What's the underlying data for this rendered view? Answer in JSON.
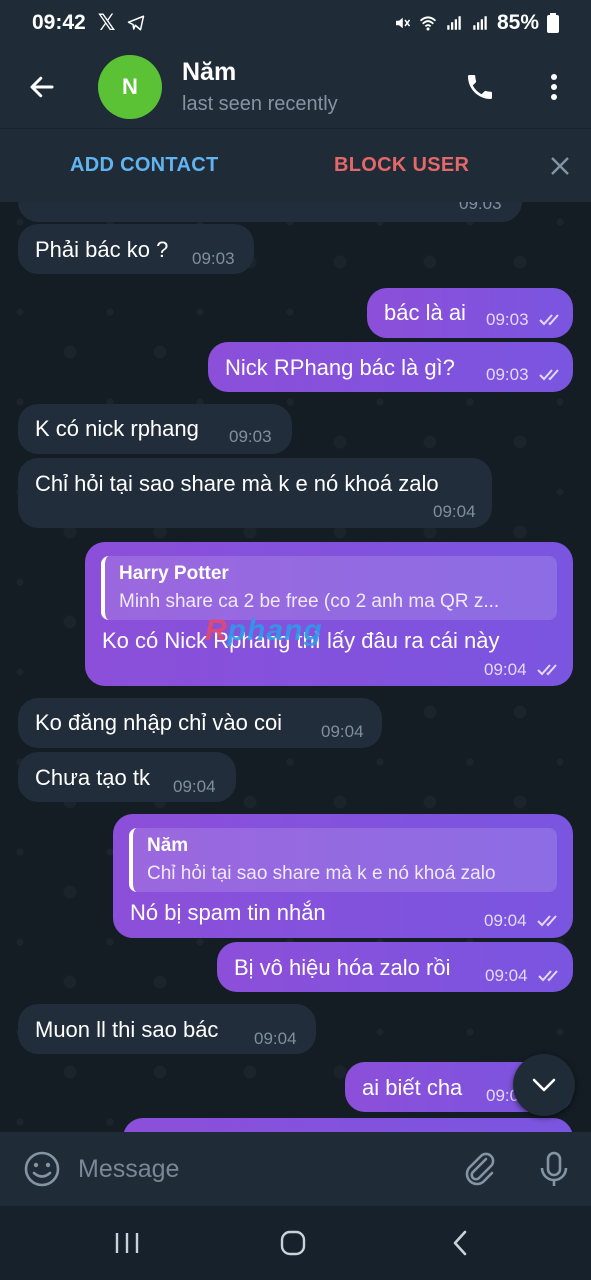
{
  "status_bar": {
    "time": "09:42",
    "battery": "85%"
  },
  "header": {
    "avatar_letter": "N",
    "name": "Năm",
    "status": "last seen recently"
  },
  "actions": {
    "add_contact": "ADD CONTACT",
    "block_user": "BLOCK USER"
  },
  "messages": [
    {
      "dir": "in",
      "text": "Phải bác ko ?",
      "time": "09:03"
    },
    {
      "dir": "out",
      "text": "bác là ai",
      "time": "09:03",
      "read": true
    },
    {
      "dir": "out",
      "text": "Nick RPhang bác là gì?",
      "time": "09:03",
      "read": true
    },
    {
      "dir": "in",
      "text": "K có nick rphang",
      "time": "09:03"
    },
    {
      "dir": "in",
      "text": "Chỉ hỏi tại sao share mà k e nó khoá zalo",
      "time": "09:04"
    },
    {
      "dir": "out",
      "reply_name": "Harry Potter",
      "reply_text": "Minh share ca 2 be free (co 2 anh ma QR z...",
      "text": "Ko có Nick Rphang thì lấy đâu ra cái này",
      "time": "09:04",
      "read": true
    },
    {
      "dir": "in",
      "text": "Ko đăng nhập chỉ vào coi",
      "time": "09:04"
    },
    {
      "dir": "in",
      "text": "Chưa tạo tk",
      "time": "09:04"
    },
    {
      "dir": "out",
      "reply_name": "Năm",
      "reply_text": "Chỉ hỏi tại sao share mà k e nó khoá zalo",
      "text": "Nó bị spam tin nhắn",
      "time": "09:04",
      "read": true
    },
    {
      "dir": "out",
      "text": "Bị vô hiệu hóa zalo rồi",
      "time": "09:04",
      "read": true
    },
    {
      "dir": "in",
      "text": "Muon ll thi sao bác",
      "time": "09:04"
    },
    {
      "dir": "out",
      "text": "ai biết cha",
      "time": "09:0",
      "read": true
    }
  ],
  "watermark": {
    "part1": "R",
    "part2": "phang"
  },
  "composer": {
    "placeholder": "Message"
  },
  "icons": {
    "back": "arrow-left-icon",
    "call": "phone-icon",
    "menu": "more-vert-icon",
    "close": "close-icon",
    "emoji": "emoji-icon",
    "attach": "paperclip-icon",
    "mic": "mic-icon",
    "scroll": "chevron-down-icon",
    "check": "double-check-icon"
  },
  "colors": {
    "accent": "#62b4f0",
    "danger": "#e46769",
    "out_bubble": "#8c4fd9",
    "in_bubble": "#212d3a",
    "avatar": "#5bc236"
  }
}
